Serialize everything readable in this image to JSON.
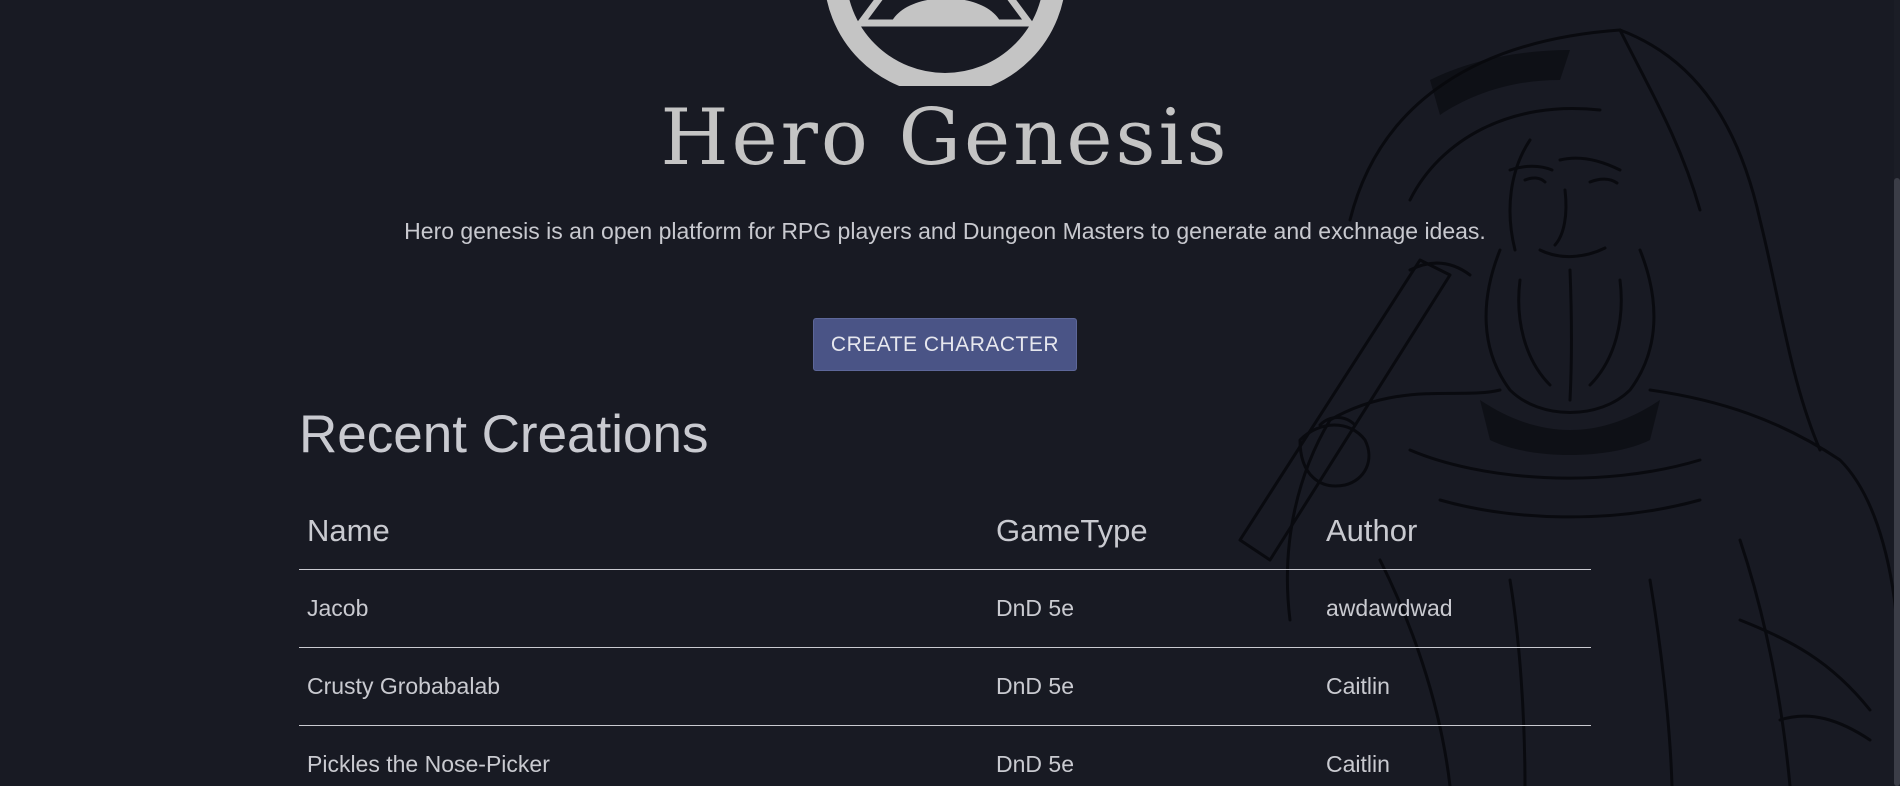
{
  "brand": {
    "title": "Hero Genesis",
    "tagline": "Hero genesis is an open platform for RPG players and Dungeon Masters to generate and exchnage ideas."
  },
  "hero": {
    "create_button_label": "CREATE CHARACTER"
  },
  "recent": {
    "title": "Recent Creations",
    "columns": [
      "Name",
      "GameType",
      "Author"
    ],
    "rows": [
      {
        "name": "Jacob",
        "game_type": "DnD 5e",
        "author": "awdawdwad"
      },
      {
        "name": "Crusty Grobabalab",
        "game_type": "DnD 5e",
        "author": "Caitlin"
      },
      {
        "name": "Pickles the Nose-Picker",
        "game_type": "DnD 5e",
        "author": "Caitlin"
      }
    ]
  },
  "icons": {
    "logo": "triangle-in-circle-logo",
    "background": "bearded-dwarf-illustration"
  },
  "colors": {
    "background": "#181a23",
    "text": "#c9cad0",
    "button": "#4a5486",
    "logo": "#c4c4c4"
  }
}
